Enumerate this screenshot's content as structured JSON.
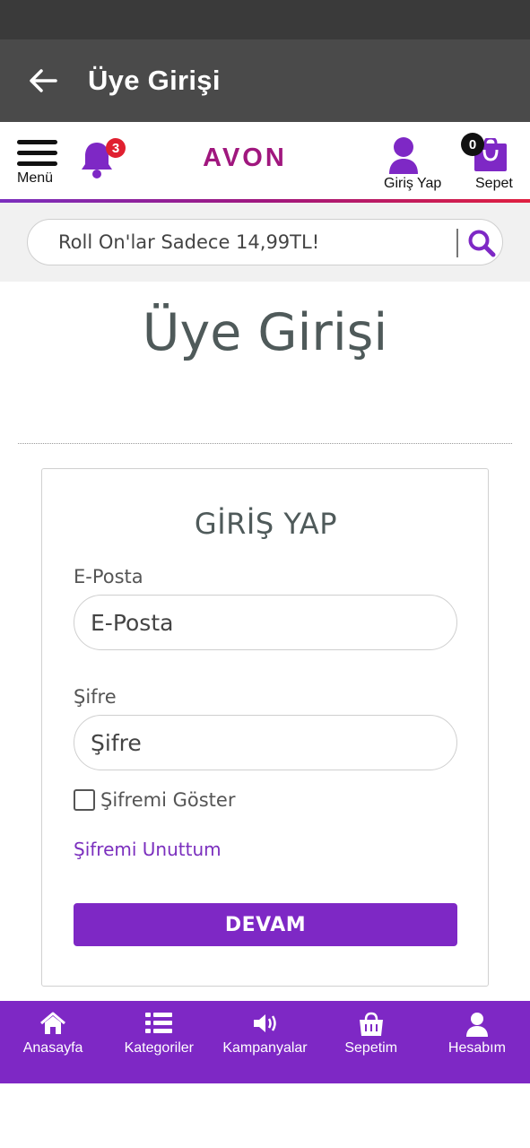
{
  "appbar": {
    "title": "Üye Girişi"
  },
  "header": {
    "menu_label": "Menü",
    "notification_count": "3",
    "logo": "AVON",
    "login_label": "Giriş Yap",
    "cart_count": "0",
    "cart_label": "Sepet"
  },
  "search": {
    "placeholder": "Roll On'lar Sadece 14,99TL!"
  },
  "page": {
    "title": "Üye Girişi"
  },
  "form": {
    "title": "GİRİŞ YAP",
    "email_label": "E-Posta",
    "email_placeholder": "E-Posta",
    "password_label": "Şifre",
    "password_placeholder": "Şifre",
    "show_password_label": "Şifremi Göster",
    "forgot_label": "Şifremi Unuttum",
    "submit_label": "DEVAM"
  },
  "bottom_nav": {
    "items": [
      {
        "label": "Anasayfa",
        "icon": "home-icon"
      },
      {
        "label": "Kategoriler",
        "icon": "list-icon"
      },
      {
        "label": "Kampanyalar",
        "icon": "megaphone-icon"
      },
      {
        "label": "Sepetim",
        "icon": "shopping-bag-icon"
      },
      {
        "label": "Hesabım",
        "icon": "user-icon"
      }
    ]
  },
  "colors": {
    "brand_purple": "#7e28c5",
    "logo": "#a0177e",
    "badge_red": "#e02030",
    "appbar": "#4a4a4a"
  }
}
